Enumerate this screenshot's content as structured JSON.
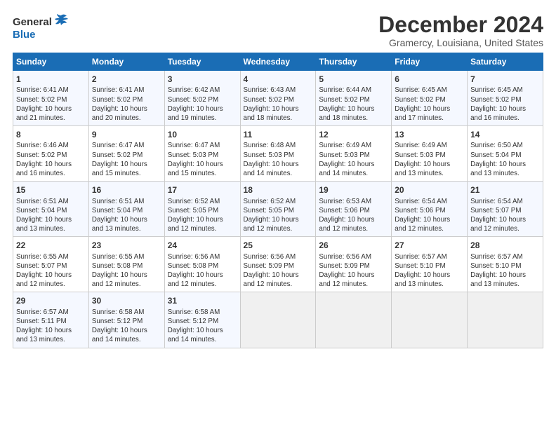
{
  "logo": {
    "general": "General",
    "blue": "Blue"
  },
  "header": {
    "month": "December 2024",
    "location": "Gramercy, Louisiana, United States"
  },
  "weekdays": [
    "Sunday",
    "Monday",
    "Tuesday",
    "Wednesday",
    "Thursday",
    "Friday",
    "Saturday"
  ],
  "weeks": [
    [
      {
        "day": "1",
        "info": "Sunrise: 6:41 AM\nSunset: 5:02 PM\nDaylight: 10 hours\nand 21 minutes."
      },
      {
        "day": "2",
        "info": "Sunrise: 6:41 AM\nSunset: 5:02 PM\nDaylight: 10 hours\nand 20 minutes."
      },
      {
        "day": "3",
        "info": "Sunrise: 6:42 AM\nSunset: 5:02 PM\nDaylight: 10 hours\nand 19 minutes."
      },
      {
        "day": "4",
        "info": "Sunrise: 6:43 AM\nSunset: 5:02 PM\nDaylight: 10 hours\nand 18 minutes."
      },
      {
        "day": "5",
        "info": "Sunrise: 6:44 AM\nSunset: 5:02 PM\nDaylight: 10 hours\nand 18 minutes."
      },
      {
        "day": "6",
        "info": "Sunrise: 6:45 AM\nSunset: 5:02 PM\nDaylight: 10 hours\nand 17 minutes."
      },
      {
        "day": "7",
        "info": "Sunrise: 6:45 AM\nSunset: 5:02 PM\nDaylight: 10 hours\nand 16 minutes."
      }
    ],
    [
      {
        "day": "8",
        "info": "Sunrise: 6:46 AM\nSunset: 5:02 PM\nDaylight: 10 hours\nand 16 minutes."
      },
      {
        "day": "9",
        "info": "Sunrise: 6:47 AM\nSunset: 5:02 PM\nDaylight: 10 hours\nand 15 minutes."
      },
      {
        "day": "10",
        "info": "Sunrise: 6:47 AM\nSunset: 5:03 PM\nDaylight: 10 hours\nand 15 minutes."
      },
      {
        "day": "11",
        "info": "Sunrise: 6:48 AM\nSunset: 5:03 PM\nDaylight: 10 hours\nand 14 minutes."
      },
      {
        "day": "12",
        "info": "Sunrise: 6:49 AM\nSunset: 5:03 PM\nDaylight: 10 hours\nand 14 minutes."
      },
      {
        "day": "13",
        "info": "Sunrise: 6:49 AM\nSunset: 5:03 PM\nDaylight: 10 hours\nand 13 minutes."
      },
      {
        "day": "14",
        "info": "Sunrise: 6:50 AM\nSunset: 5:04 PM\nDaylight: 10 hours\nand 13 minutes."
      }
    ],
    [
      {
        "day": "15",
        "info": "Sunrise: 6:51 AM\nSunset: 5:04 PM\nDaylight: 10 hours\nand 13 minutes."
      },
      {
        "day": "16",
        "info": "Sunrise: 6:51 AM\nSunset: 5:04 PM\nDaylight: 10 hours\nand 13 minutes."
      },
      {
        "day": "17",
        "info": "Sunrise: 6:52 AM\nSunset: 5:05 PM\nDaylight: 10 hours\nand 12 minutes."
      },
      {
        "day": "18",
        "info": "Sunrise: 6:52 AM\nSunset: 5:05 PM\nDaylight: 10 hours\nand 12 minutes."
      },
      {
        "day": "19",
        "info": "Sunrise: 6:53 AM\nSunset: 5:06 PM\nDaylight: 10 hours\nand 12 minutes."
      },
      {
        "day": "20",
        "info": "Sunrise: 6:54 AM\nSunset: 5:06 PM\nDaylight: 10 hours\nand 12 minutes."
      },
      {
        "day": "21",
        "info": "Sunrise: 6:54 AM\nSunset: 5:07 PM\nDaylight: 10 hours\nand 12 minutes."
      }
    ],
    [
      {
        "day": "22",
        "info": "Sunrise: 6:55 AM\nSunset: 5:07 PM\nDaylight: 10 hours\nand 12 minutes."
      },
      {
        "day": "23",
        "info": "Sunrise: 6:55 AM\nSunset: 5:08 PM\nDaylight: 10 hours\nand 12 minutes."
      },
      {
        "day": "24",
        "info": "Sunrise: 6:56 AM\nSunset: 5:08 PM\nDaylight: 10 hours\nand 12 minutes."
      },
      {
        "day": "25",
        "info": "Sunrise: 6:56 AM\nSunset: 5:09 PM\nDaylight: 10 hours\nand 12 minutes."
      },
      {
        "day": "26",
        "info": "Sunrise: 6:56 AM\nSunset: 5:09 PM\nDaylight: 10 hours\nand 12 minutes."
      },
      {
        "day": "27",
        "info": "Sunrise: 6:57 AM\nSunset: 5:10 PM\nDaylight: 10 hours\nand 13 minutes."
      },
      {
        "day": "28",
        "info": "Sunrise: 6:57 AM\nSunset: 5:10 PM\nDaylight: 10 hours\nand 13 minutes."
      }
    ],
    [
      {
        "day": "29",
        "info": "Sunrise: 6:57 AM\nSunset: 5:11 PM\nDaylight: 10 hours\nand 13 minutes."
      },
      {
        "day": "30",
        "info": "Sunrise: 6:58 AM\nSunset: 5:12 PM\nDaylight: 10 hours\nand 14 minutes."
      },
      {
        "day": "31",
        "info": "Sunrise: 6:58 AM\nSunset: 5:12 PM\nDaylight: 10 hours\nand 14 minutes."
      },
      null,
      null,
      null,
      null
    ]
  ]
}
